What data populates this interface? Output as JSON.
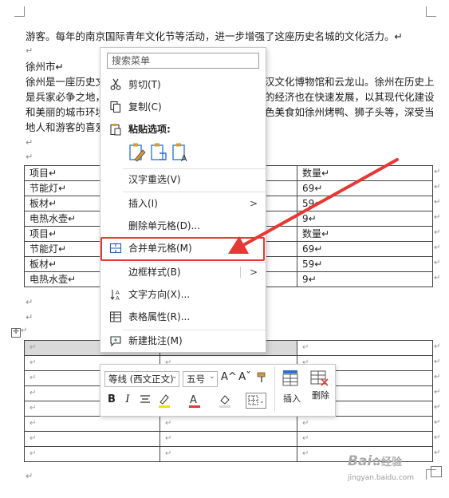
{
  "document": {
    "para_end_mark": "↵",
    "text_line1": "游客。每年的南京国际青年文化节等活动，进一步增强了这座历史名城的文化活力。↵",
    "heading": "徐州市↵",
    "body_left": [
      "徐州是一座历史文",
      "是兵家必争之地，",
      "和美丽的城市环境",
      "地人和游客的喜爱"
    ],
    "body_right": [
      "汉文化博物馆和云龙山。徐州在历史上",
      "的经济也在快速发展，以其现代化建设",
      "色美食如徐州烤鸭、狮子头等，深受当",
      ""
    ]
  },
  "table1": {
    "rows": [
      {
        "c1": "项目↵",
        "c3": "数量↵"
      },
      {
        "c1": "节能灯↵",
        "c3": "69↵"
      },
      {
        "c1": "板材↵",
        "c3": "59↵"
      },
      {
        "c1": "电热水壶↵",
        "c3": "9↵"
      },
      {
        "c1": "项目↵",
        "c3": "数量↵"
      },
      {
        "c1": "节能灯↵",
        "c3": "69↵"
      },
      {
        "c1": "板材↵",
        "c3": "59↵"
      },
      {
        "c1": "电热水壶↵",
        "c3": "9↵"
      }
    ]
  },
  "table2": {
    "cell_mark": "↵",
    "row_count": 8
  },
  "context_menu": {
    "search_placeholder": "搜索菜单",
    "cut": "剪切(T)",
    "copy": "复制(C)",
    "paste_options": "粘贴选项:",
    "reconvert": "汉字重选(V)",
    "insert": "插入(I)",
    "delete_cells": "删除单元格(D)...",
    "merge_cells": "合并单元格(M)",
    "borders": "边框样式(B)",
    "text_direction": "文字方向(X)...",
    "table_props": "表格属性(R)...",
    "new_comment": "新建批注(M)"
  },
  "mini_toolbar": {
    "font": "等线 (西文正文)",
    "size": "五号",
    "grow": "A^",
    "shrink": "Aˇ",
    "bold": "B",
    "italic": "I",
    "insert": "插入",
    "delete": "删除"
  },
  "watermark": {
    "brand": "Bai",
    "brand2": "经验",
    "url": "jingyan.baidu.com"
  },
  "colors": {
    "accent_red": "#e53935",
    "highlight": "#f2e200",
    "selected_cell": "#d9d9d9"
  }
}
